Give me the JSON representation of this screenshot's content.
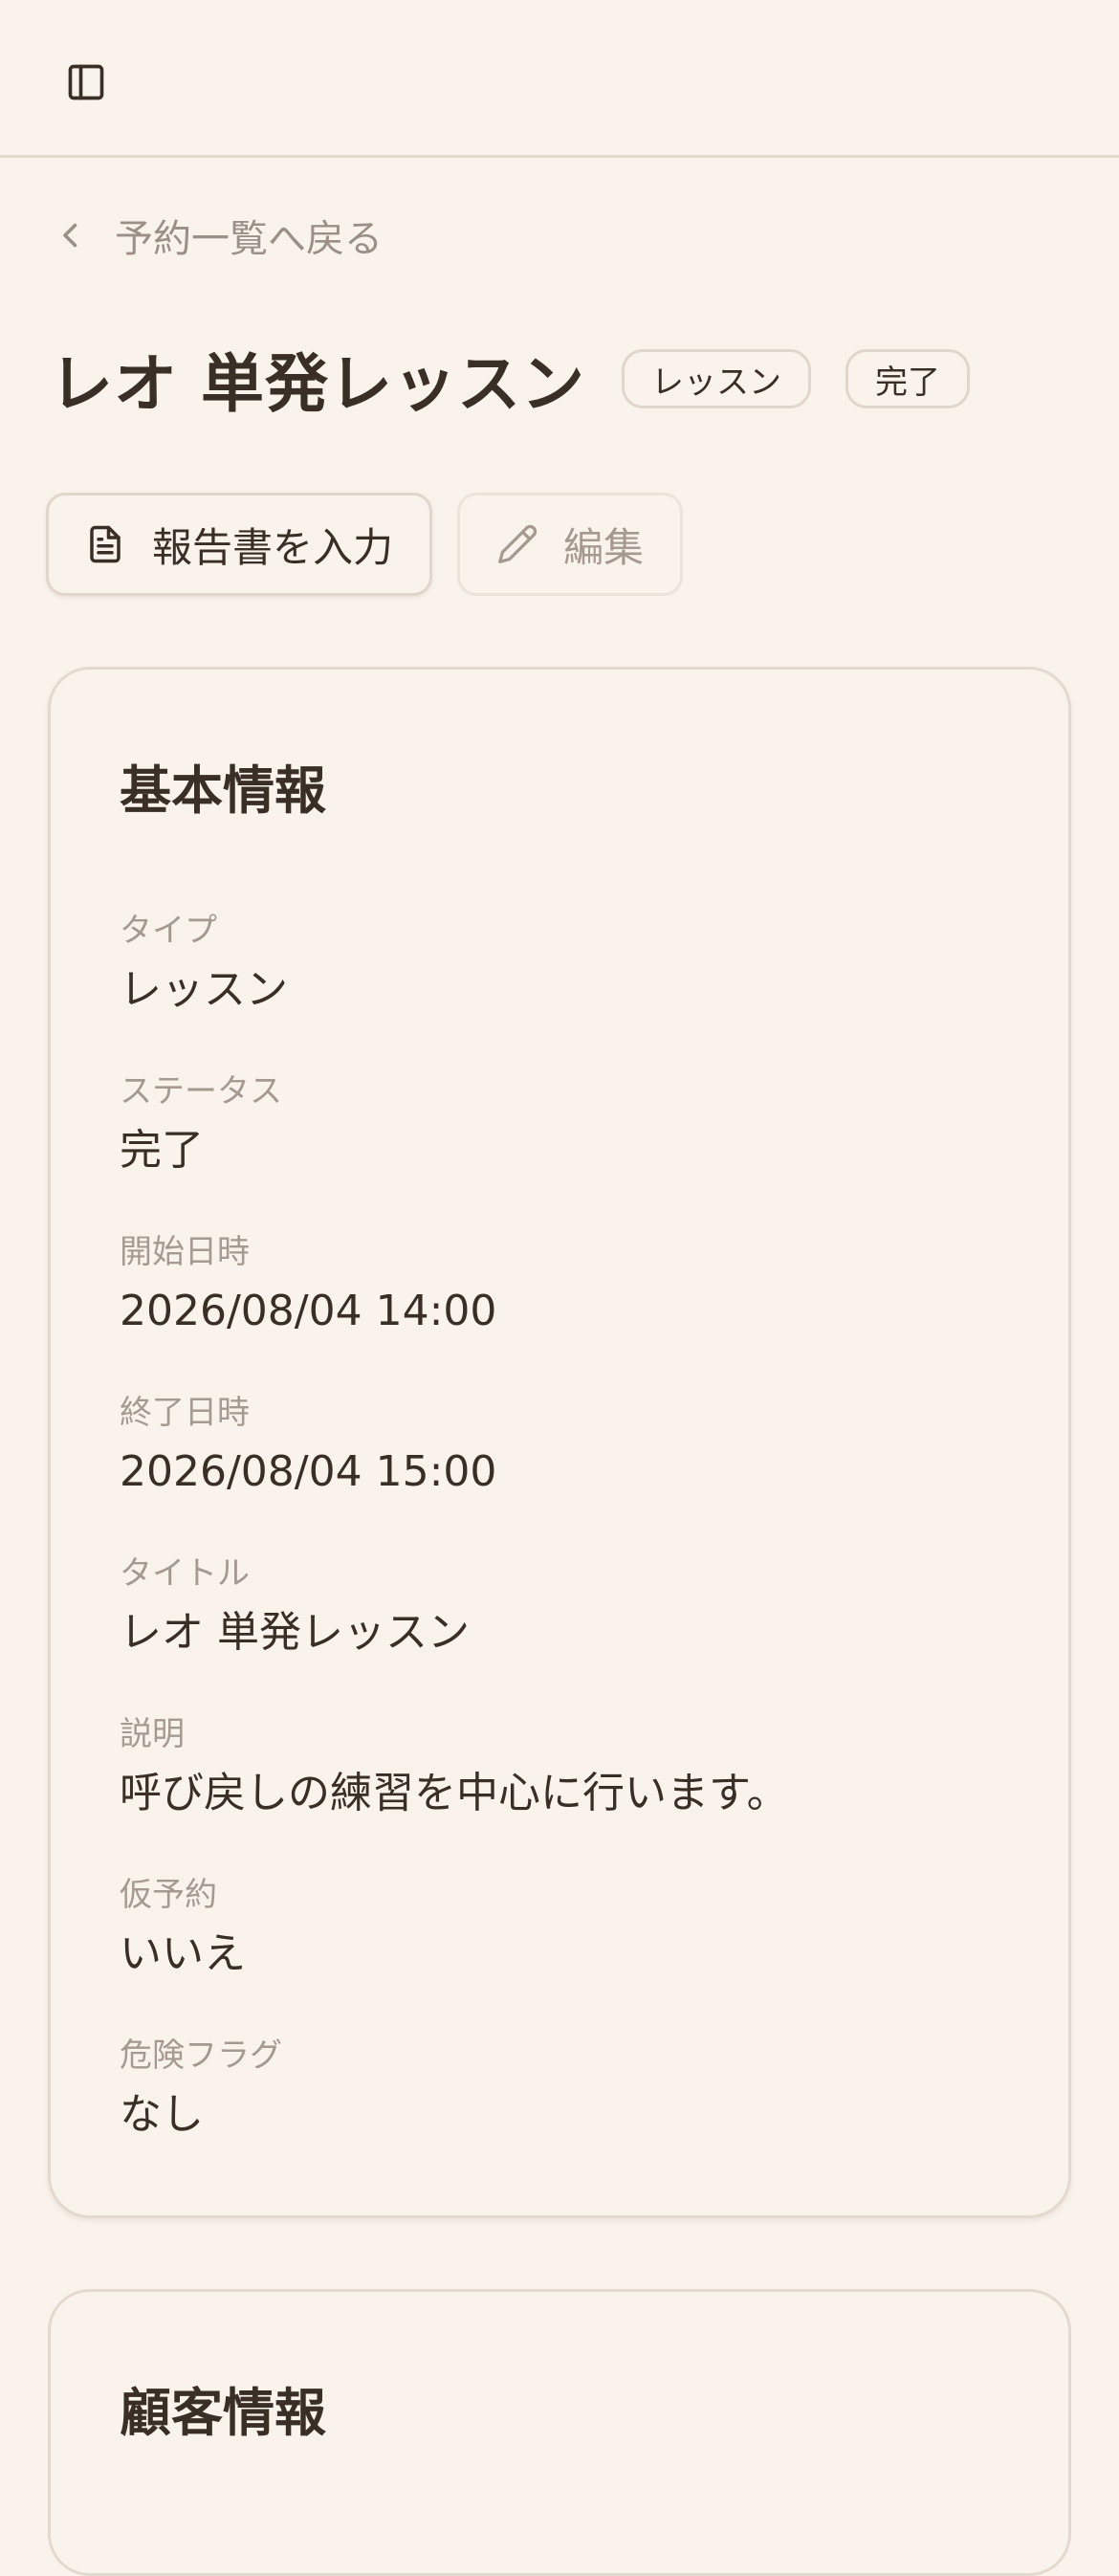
{
  "header": {
    "sidebar_toggle_icon": "sidebar-panel-icon"
  },
  "back_link": {
    "label": "予約一覧へ戻る",
    "icon": "chevron-left-icon"
  },
  "page": {
    "title": "レオ 単発レッスン",
    "badges": [
      "レッスン",
      "完了"
    ]
  },
  "actions": {
    "report_label": "報告書を入力",
    "report_icon": "document-icon",
    "edit_label": "編集",
    "edit_icon": "pencil-icon"
  },
  "basic_info": {
    "title": "基本情報",
    "fields": [
      {
        "label": "タイプ",
        "value": "レッスン"
      },
      {
        "label": "ステータス",
        "value": "完了"
      },
      {
        "label": "開始日時",
        "value": "2026/08/04 14:00"
      },
      {
        "label": "終了日時",
        "value": "2026/08/04 15:00"
      },
      {
        "label": "タイトル",
        "value": "レオ 単発レッスン"
      },
      {
        "label": "説明",
        "value": "呼び戻しの練習を中心に行います。"
      },
      {
        "label": "仮予約",
        "value": "いいえ"
      },
      {
        "label": "危険フラグ",
        "value": "なし"
      }
    ]
  },
  "customer_info": {
    "title": "顧客情報"
  },
  "colors": {
    "background": "#faf3ec",
    "text": "#3a2f26",
    "muted": "#a59a91",
    "border": "#e3d9cf"
  }
}
